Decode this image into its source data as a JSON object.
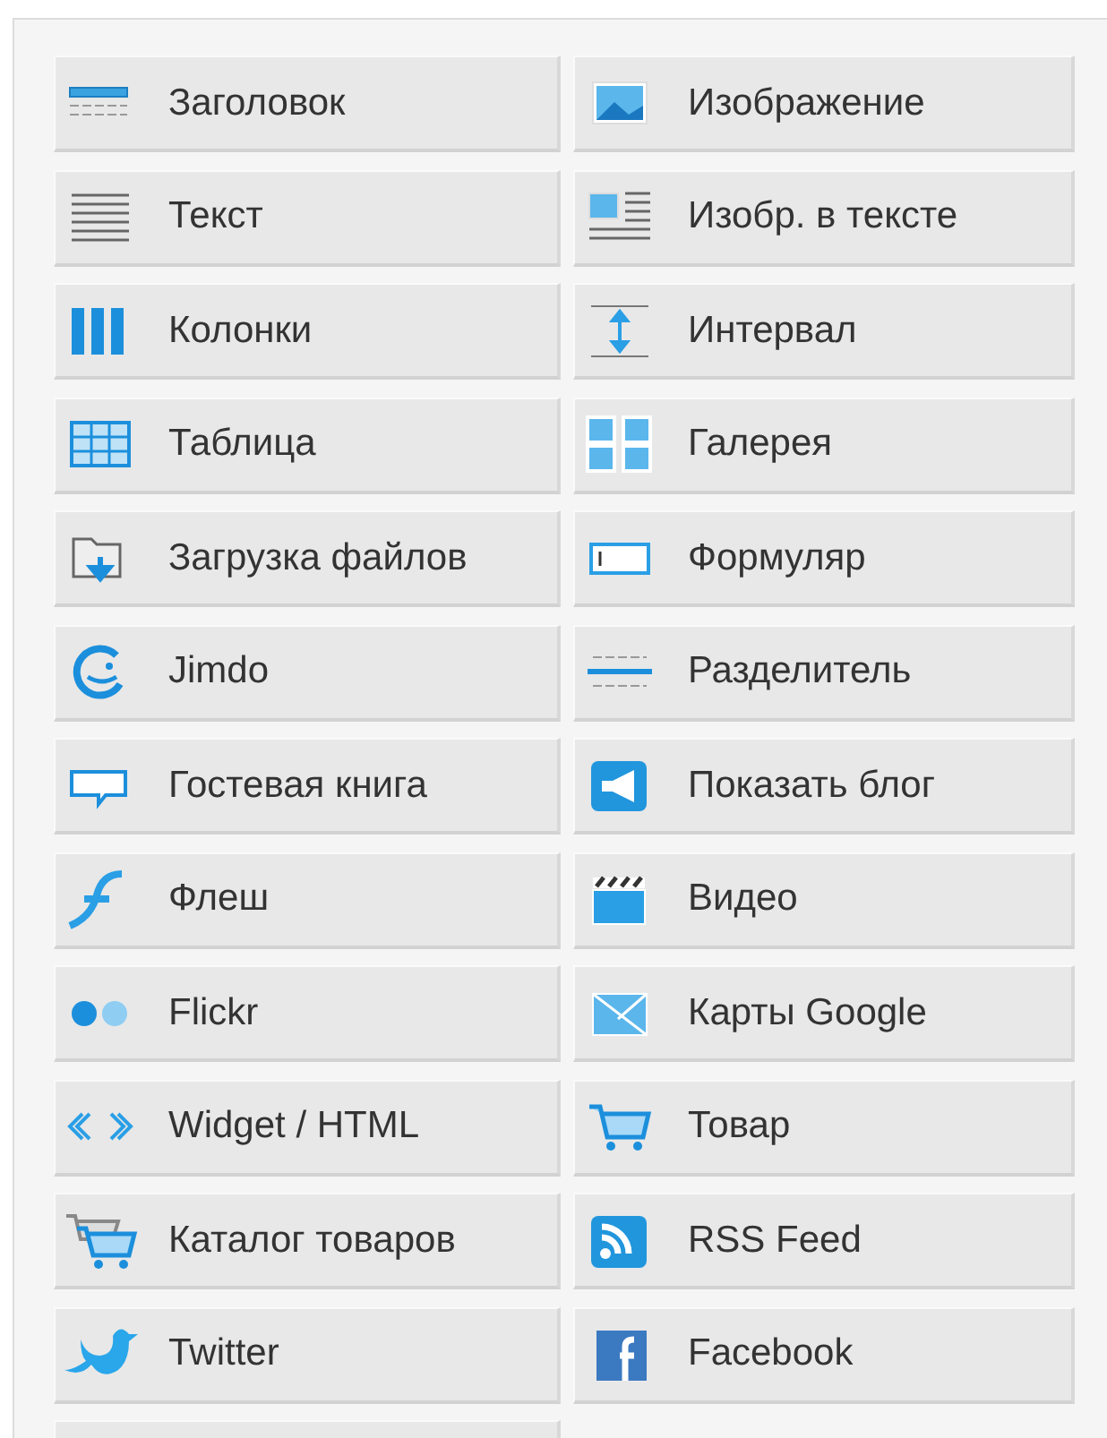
{
  "items": [
    {
      "label": "Заголовок",
      "kind": "heading"
    },
    {
      "label": "Изображение",
      "kind": "image"
    },
    {
      "label": "Текст",
      "kind": "text"
    },
    {
      "label": "Изобр. в тексте",
      "kind": "image-text"
    },
    {
      "label": "Колонки",
      "kind": "columns"
    },
    {
      "label": "Интервал",
      "kind": "spacing"
    },
    {
      "label": "Таблица",
      "kind": "table"
    },
    {
      "label": "Галерея",
      "kind": "gallery"
    },
    {
      "label": "Загрузка файлов",
      "kind": "download"
    },
    {
      "label": "Формуляр",
      "kind": "form"
    },
    {
      "label": "Jimdo",
      "kind": "smiley"
    },
    {
      "label": "Разделитель",
      "kind": "divider"
    },
    {
      "label": "Гостевая книга",
      "kind": "speech"
    },
    {
      "label": "Показать блог",
      "kind": "megaphone"
    },
    {
      "label": "Флеш",
      "kind": "flash"
    },
    {
      "label": "Видео",
      "kind": "video"
    },
    {
      "label": "Flickr",
      "kind": "dots"
    },
    {
      "label": "Карты Google",
      "kind": "map"
    },
    {
      "label": "Widget / HTML",
      "kind": "code"
    },
    {
      "label": "Товар",
      "kind": "cart"
    },
    {
      "label": "Каталог товаров",
      "kind": "carts"
    },
    {
      "label": "RSS Feed",
      "kind": "rss"
    },
    {
      "label": "Twitter",
      "kind": "bird"
    },
    {
      "label": "Facebook",
      "kind": "facebook"
    }
  ]
}
